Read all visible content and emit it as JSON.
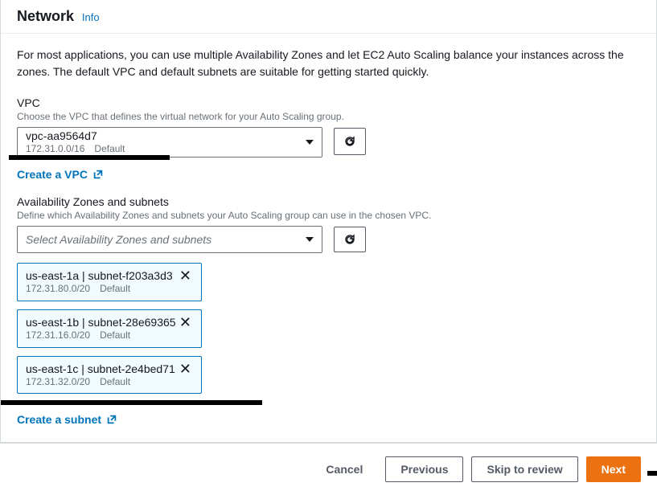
{
  "header": {
    "title": "Network",
    "info": "Info"
  },
  "intro": "For most applications, you can use multiple Availability Zones and let EC2 Auto Scaling balance your instances across the zones. The default VPC and default subnets are suitable for getting started quickly.",
  "vpc": {
    "label": "VPC",
    "desc": "Choose the VPC that defines the virtual network for your Auto Scaling group.",
    "selected_id": "vpc-aa9564d7",
    "selected_cidr": "172.31.0.0/16",
    "selected_tag": "Default",
    "create_link": "Create a VPC"
  },
  "az": {
    "label": "Availability Zones and subnets",
    "desc": "Define which Availability Zones and subnets your Auto Scaling group can use in the chosen VPC.",
    "placeholder": "Select Availability Zones and subnets",
    "chips": [
      {
        "title": "us-east-1a | subnet-f203a3d3",
        "cidr": "172.31.80.0/20",
        "tag": "Default"
      },
      {
        "title": "us-east-1b | subnet-28e69365",
        "cidr": "172.31.16.0/20",
        "tag": "Default"
      },
      {
        "title": "us-east-1c | subnet-2e4bed71",
        "cidr": "172.31.32.0/20",
        "tag": "Default"
      }
    ],
    "create_link": "Create a subnet"
  },
  "footer": {
    "cancel": "Cancel",
    "previous": "Previous",
    "skip": "Skip to review",
    "next": "Next"
  }
}
